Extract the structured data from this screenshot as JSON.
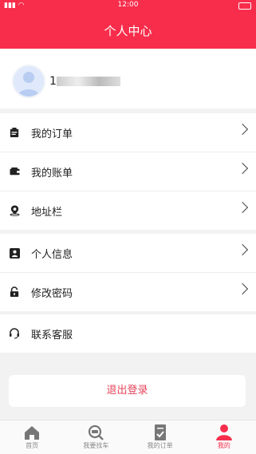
{
  "status": {
    "time": "12:00"
  },
  "header": {
    "title": "个人中心"
  },
  "profile": {
    "username_prefix": "1"
  },
  "menu1": [
    {
      "label": "我的订单",
      "icon": "clipboard-icon"
    },
    {
      "label": "我的账单",
      "icon": "wallet-icon"
    },
    {
      "label": "地址栏",
      "icon": "location-pin-icon"
    }
  ],
  "menu2": [
    {
      "label": "个人信息",
      "icon": "contact-card-icon"
    },
    {
      "label": "修改密码",
      "icon": "lock-icon"
    }
  ],
  "menu3": [
    {
      "label": "联系客服",
      "icon": "headset-icon"
    }
  ],
  "logout": {
    "label": "退出登录"
  },
  "tabbar": [
    {
      "label": "首页",
      "icon": "home-icon"
    },
    {
      "label": "我要找车",
      "icon": "find-car-icon"
    },
    {
      "label": "我的订单",
      "icon": "order-icon"
    },
    {
      "label": "我的",
      "icon": "user-icon",
      "active": true
    }
  ],
  "colors": {
    "accent": "#f72d4b",
    "logout_text": "#e8445a"
  }
}
